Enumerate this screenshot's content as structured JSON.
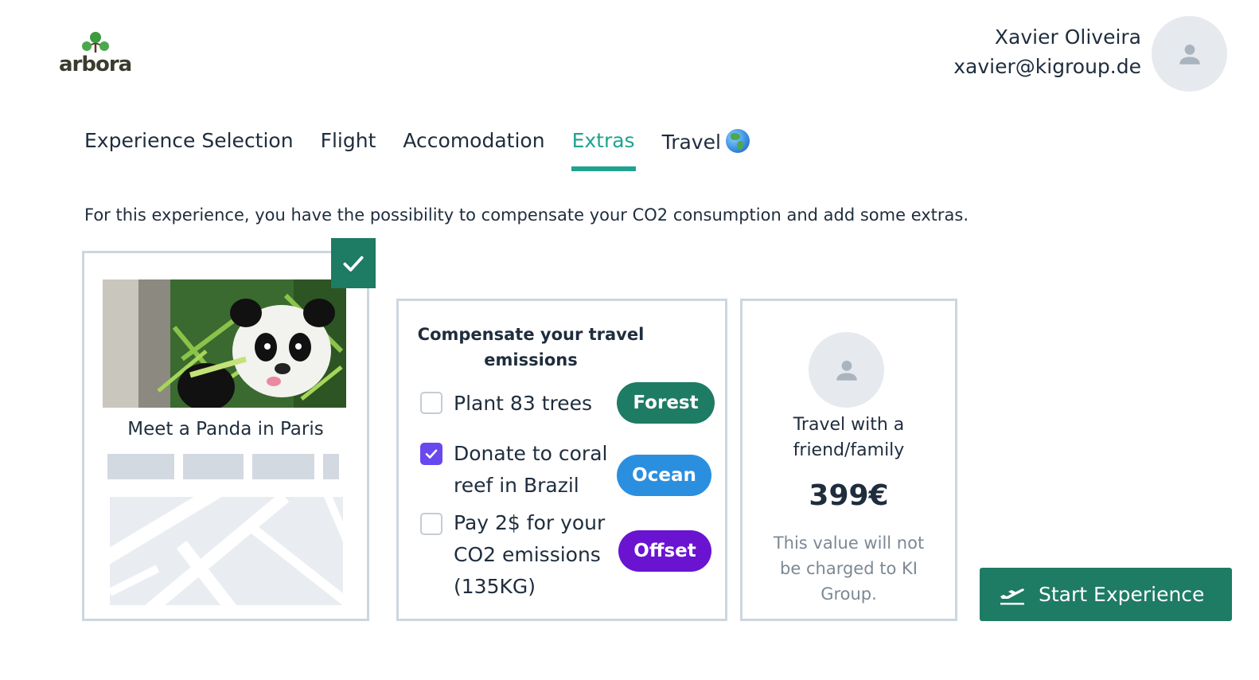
{
  "brand": {
    "name": "arbora"
  },
  "user": {
    "name": "Xavier Oliveira",
    "email": "xavier@kigroup.de"
  },
  "tabs": [
    {
      "label": "Experience Selection",
      "active": false
    },
    {
      "label": "Flight",
      "active": false
    },
    {
      "label": "Accomodation",
      "active": false
    },
    {
      "label": "Extras",
      "active": true
    },
    {
      "label": "Travel",
      "active": false,
      "icon": "globe-icon"
    }
  ],
  "intro": "For this experience, you have the possibility to compensate your CO2 consumption and add some extras.",
  "experience": {
    "title": "Meet a Panda in Paris",
    "selected": true
  },
  "compensation": {
    "title": "Compensate your travel emissions",
    "options": [
      {
        "label_lines": [
          "Plant 83 trees"
        ],
        "checked": false,
        "tag": "Forest",
        "tag_color": "#1e7b64"
      },
      {
        "label_lines": [
          "Donate to coral",
          "reef in Brazil"
        ],
        "checked": true,
        "tag": "Ocean",
        "tag_color": "#2b8fe0"
      },
      {
        "label_lines": [
          "Pay 2$ for your",
          "CO2 emissions",
          "(135KG)"
        ],
        "checked": false,
        "tag": "Offset",
        "tag_color": "#6a14d1"
      }
    ]
  },
  "friend": {
    "label_lines": [
      "Travel with a",
      "friend/family"
    ],
    "price": "399€",
    "note_lines": [
      "This value will not",
      "be charged to KI",
      "Group."
    ]
  },
  "cta": {
    "label": "Start Experience"
  },
  "colors": {
    "accent": "#1fa38f",
    "primary": "#1e7b64",
    "checkbox": "#6a48f0",
    "border": "#cdd6df"
  }
}
